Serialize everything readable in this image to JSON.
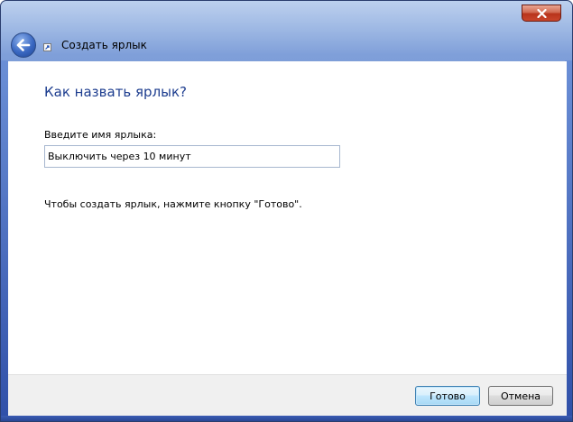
{
  "window": {
    "title": "Создать ярлык"
  },
  "wizard": {
    "heading": "Как назвать ярлык?",
    "name_label": "Введите имя ярлыка:",
    "name_value": "Выключить через 10 минут",
    "hint": "Чтобы создать ярлык, нажмите кнопку \"Готово\"."
  },
  "buttons": {
    "finish": "Готово",
    "cancel": "Отмена"
  },
  "icons": {
    "close": "close-icon",
    "back": "back-arrow-icon",
    "shortcut": "shortcut-icon"
  },
  "colors": {
    "heading": "#1d3d8f",
    "close_button": "#c9452b",
    "default_button_border": "#3c7fb1"
  }
}
